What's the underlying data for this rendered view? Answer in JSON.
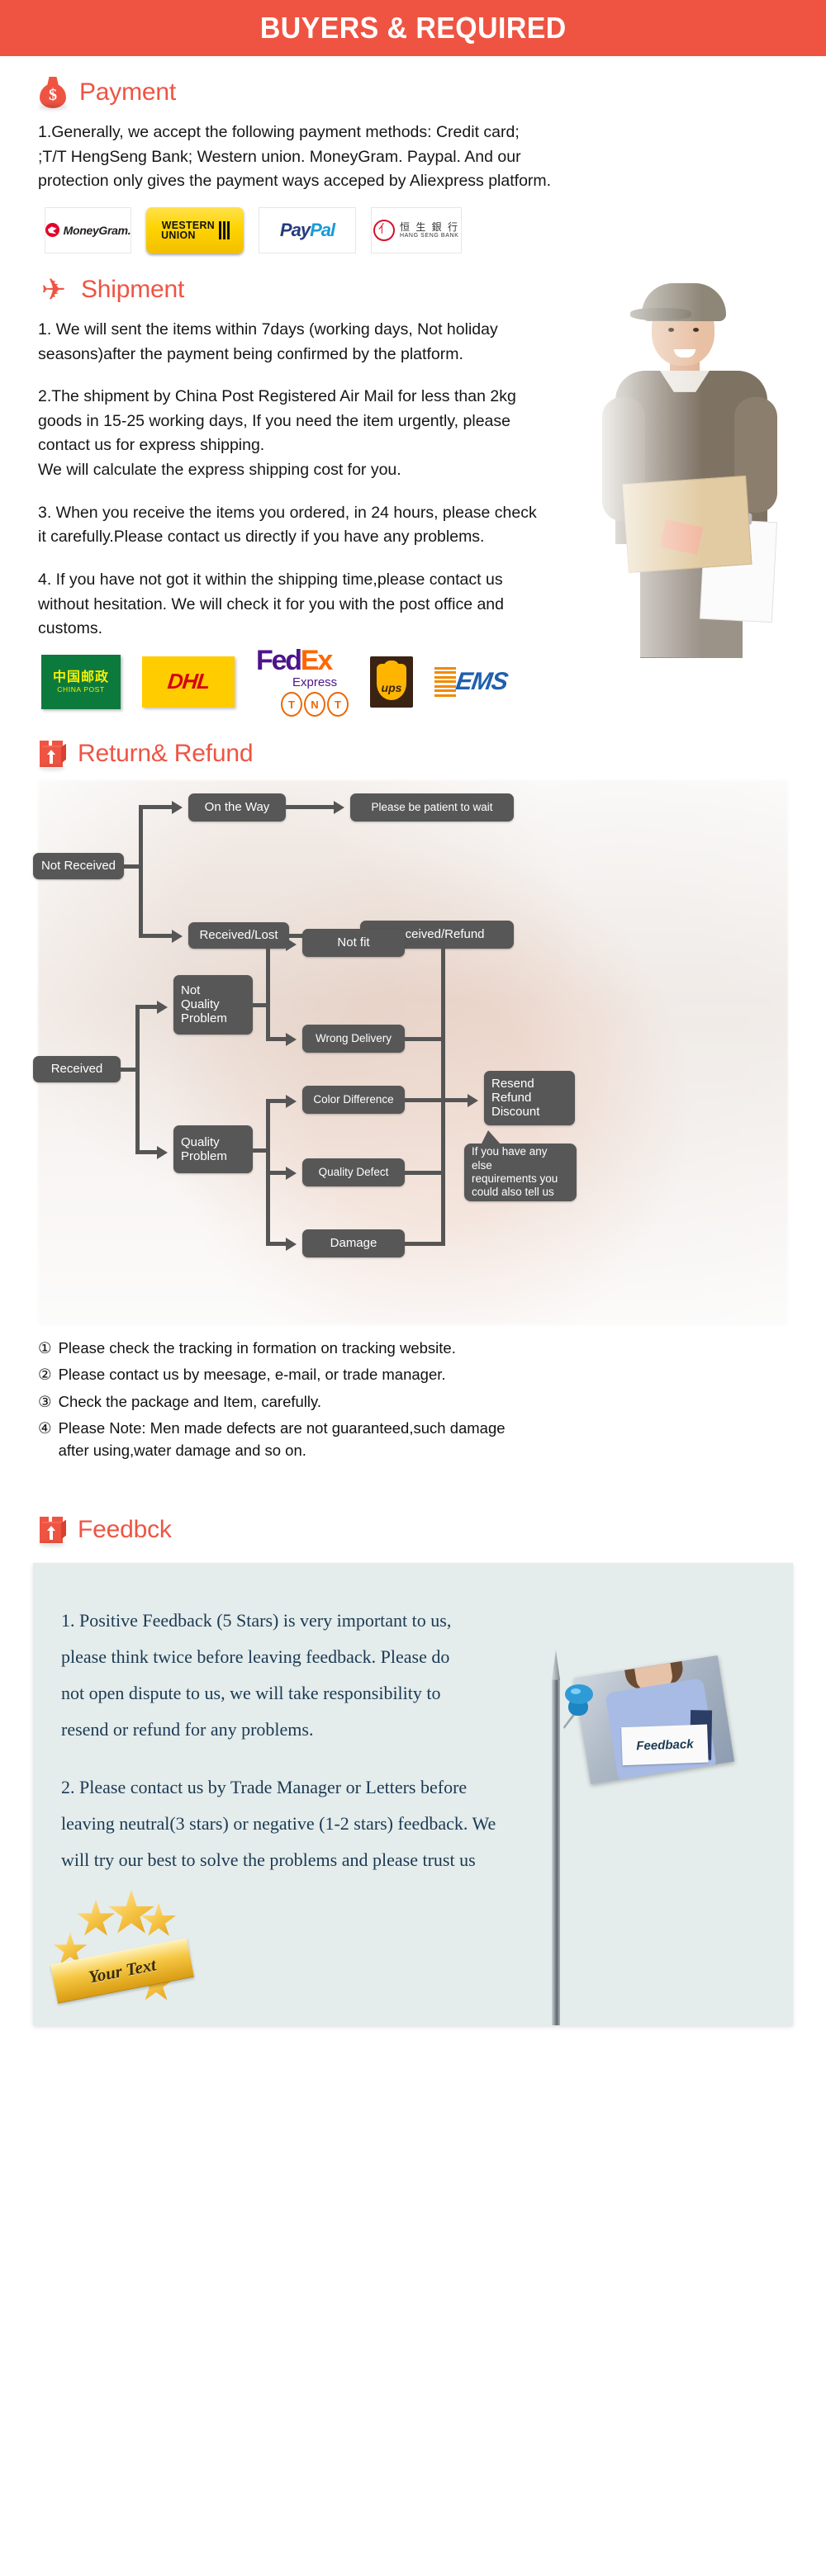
{
  "banner": {
    "title": "BUYERS & REQUIRED"
  },
  "payment": {
    "icon": "money-bag-icon",
    "heading": "Payment",
    "body": "1.Generally, we accept the following payment methods: Credit card;\n;T/T HengSeng Bank; Western union. MoneyGram. Paypal. And our\nprotection only gives the payment ways acceped by Aliexpress platform.",
    "logos": [
      {
        "name": "moneygram-logo",
        "label": "MoneyGram."
      },
      {
        "name": "western-union-logo",
        "line1": "WESTERN",
        "line2": "UNION"
      },
      {
        "name": "paypal-logo",
        "part1": "Pay",
        "part2": "Pal"
      },
      {
        "name": "hang-seng-bank-logo",
        "cn": "恒 生 銀 行",
        "en": "HANG SENG BANK"
      }
    ]
  },
  "shipment": {
    "icon": "airplane-icon",
    "heading": "Shipment",
    "para1": "1. We will sent the items within 7days (working days, Not holiday\nseasons)after the payment being confirmed by the platform.",
    "para2": "2.The shipment by China Post Registered Air Mail for less than  2kg\ngoods in 15-25 working days, If  you need the item urgently, please\ncontact us for express shipping.\nWe will calculate the express shipping cost for you.",
    "para3": "3. When you receive the items you ordered, in 24 hours, please check\n it carefully.Please contact us directly if you have any problems.",
    "para4": "4. If you have not got it within the shipping time,please contact us\nwithout hesitation. We will check it for you with the post office and\ncustoms.",
    "carriers": [
      {
        "name": "china-post-logo",
        "cn": "中国邮政",
        "en": "CHINA POST"
      },
      {
        "name": "dhl-logo",
        "label": "DHL"
      },
      {
        "name": "fedex-logo",
        "part1": "Fed",
        "part2": "Ex",
        "sub": "Express"
      },
      {
        "name": "tnt-logo",
        "letters": [
          "T",
          "N",
          "T"
        ]
      },
      {
        "name": "ups-logo",
        "label": "ups"
      },
      {
        "name": "ems-logo",
        "label": "EMS"
      }
    ]
  },
  "returns": {
    "icon": "open-box-icon",
    "heading": "Return& Refund",
    "flow_nodes": [
      {
        "id": "not-received",
        "label": "Not Received"
      },
      {
        "id": "on-the-way",
        "label": "On the Way"
      },
      {
        "id": "please-wait",
        "label": "Please be patient to wait"
      },
      {
        "id": "received-lost",
        "label": "Received/Lost"
      },
      {
        "id": "received-refund",
        "label": "Received/Refund"
      },
      {
        "id": "received",
        "label": "Received"
      },
      {
        "id": "not-quality-problem",
        "label": "Not\nQuality\nProblem"
      },
      {
        "id": "quality-problem",
        "label": "Quality\nProblem"
      },
      {
        "id": "not-fit",
        "label": "Not fit"
      },
      {
        "id": "wrong-delivery",
        "label": "Wrong Delivery"
      },
      {
        "id": "color-difference",
        "label": "Color Difference"
      },
      {
        "id": "quality-defect",
        "label": "Quality Defect"
      },
      {
        "id": "damage",
        "label": "Damage"
      },
      {
        "id": "resend-refund-discount",
        "label": "Resend\nRefund\nDiscount"
      },
      {
        "id": "extra-requirements",
        "label": "If you have any else\nrequirements you\ncould also tell us"
      }
    ],
    "notes": [
      {
        "num": "①",
        "text": "Please check the tracking in formation on tracking website."
      },
      {
        "num": "②",
        "text": "Please contact us by meesage, e-mail, or trade manager."
      },
      {
        "num": "③",
        "text": "Check the package and Item, carefully."
      },
      {
        "num": "④",
        "text": "Please Note: Men made defects  are not guaranteed,such damage\n    after using,water damage and so on."
      }
    ]
  },
  "feedback": {
    "icon": "open-box-icon",
    "heading": "Feedbck",
    "photo_sign_text": "Feedback",
    "para1": "1. Positive Feedback (5 Stars) is very important to us,\nplease think twice before leaving feedback. Please do\nnot open dispute to us,   we will take responsibility to\nresend or refund for any problems.",
    "para2": "2. Please contact us by Trade Manager or Letters before\nleaving neutral(3 stars) or negative (1-2 stars) feedback. We\nwill try our best to solve the problems and please trust us",
    "badge_text": "Your Text"
  },
  "colors": {
    "brand_red": "#ef5443",
    "node_gray": "#575757",
    "panel_bg": "#e4ecec",
    "panel_text": "#1b3a52"
  }
}
